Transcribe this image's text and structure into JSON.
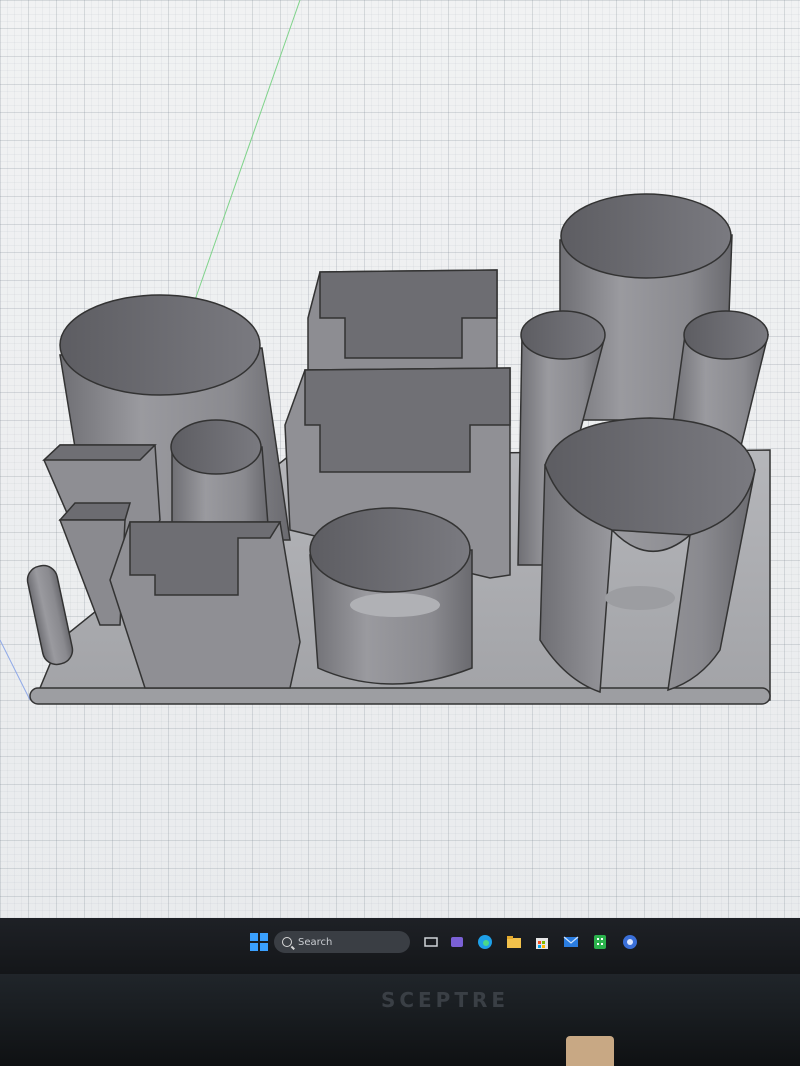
{
  "viewport": {
    "background": "#eceeef",
    "part_color": "#8b8b90"
  },
  "taskbar": {
    "search_placeholder": "Search",
    "apps": [
      "start-icon",
      "task-view-icon",
      "chat-icon",
      "edge-icon",
      "file-explorer-icon",
      "store-icon",
      "mail-icon",
      "green-app-icon",
      "cad-app-icon"
    ]
  },
  "monitor": {
    "brand": "SCEPTRE"
  }
}
